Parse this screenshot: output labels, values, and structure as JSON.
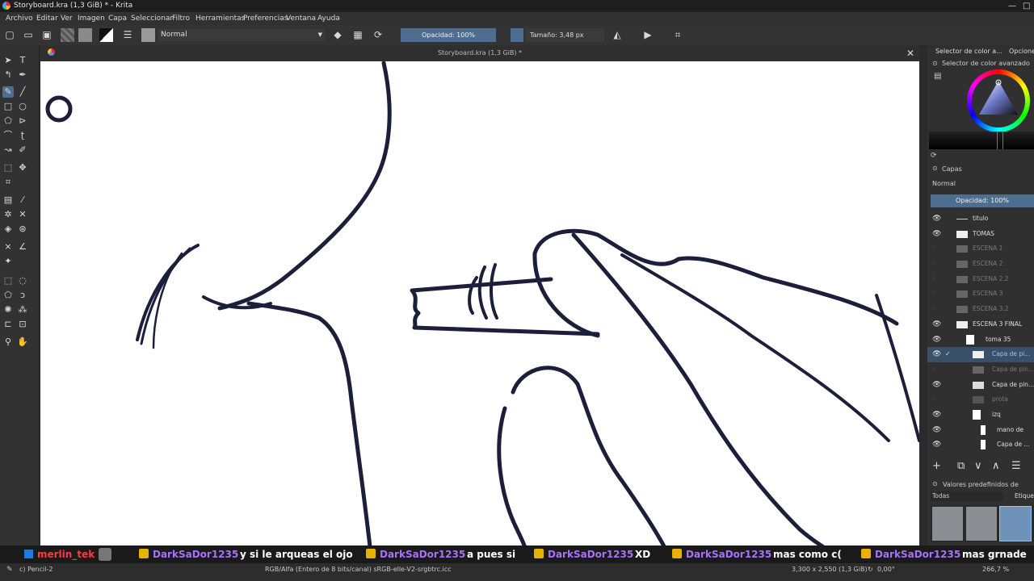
{
  "window": {
    "title": "Storyboard.kra (1,3 GiB) * - Krita"
  },
  "menu": [
    "Archivo",
    "Editar",
    "Ver",
    "Imagen",
    "Capa",
    "Seleccionar",
    "Filtro",
    "Herramientas",
    "Preferencias",
    "Ventana",
    "Ayuda"
  ],
  "toolbar": {
    "blend_mode": "Normal",
    "opacity": "Opacidad: 100%",
    "size": "Tamaño: 3,48 px"
  },
  "document": {
    "tab_title": "Storyboard.kra (1,3 GiB) *"
  },
  "colors": {
    "accent": "#4e6e8f",
    "stroke": "#1c1f3a",
    "canvas": "#ffffff"
  },
  "right_panel": {
    "tab1": "Selector de color a...",
    "tab2": "Opcione",
    "color_selector_title": "Selector de color avanzado",
    "layers_title": "Capas",
    "layers_blend": "Normal",
    "layers_opacity": "Opacidad:  100%",
    "layers": [
      {
        "name": "titulo",
        "visible": true
      },
      {
        "name": "TOMAS",
        "visible": true
      },
      {
        "name": "ESCENA 1",
        "visible": false
      },
      {
        "name": "ESCENA 2",
        "visible": false
      },
      {
        "name": "ESCENA 2.2",
        "visible": false
      },
      {
        "name": "ESCENA 3",
        "visible": false
      },
      {
        "name": "ESCENA 3.2",
        "visible": false
      },
      {
        "name": "ESCENA 3 FINAL",
        "visible": true
      },
      {
        "name": "toma 35",
        "visible": true
      },
      {
        "name": "Capa de pi...",
        "visible": true,
        "selected": true
      },
      {
        "name": "Capa de pin...",
        "visible": false
      },
      {
        "name": "Capa de pin...",
        "visible": true
      },
      {
        "name": "prota",
        "visible": false
      },
      {
        "name": "izq",
        "visible": true
      },
      {
        "name": "mano de",
        "visible": true
      },
      {
        "name": "Capa de ...",
        "visible": true
      }
    ],
    "brush_presets_title": "Valores predefinidos de pincel",
    "brush_filter": "Todas",
    "brush_tag": "Etique"
  },
  "chat": [
    {
      "user": "merlin_tek",
      "msg": "",
      "color": "#ff3b3b"
    },
    {
      "user": "DarkSaDor1235",
      "msg": "y si le arqueas el ojo"
    },
    {
      "user": "DarkSaDor1235",
      "msg": "a pues si"
    },
    {
      "user": "DarkSaDor1235",
      "msg": "XD"
    },
    {
      "user": "DarkSaDor1235",
      "msg": "mas como c("
    },
    {
      "user": "DarkSaDor1235",
      "msg": "mas grnade"
    }
  ],
  "status": {
    "tool": "c) Pencil-2",
    "color_profile": "RGB/Alfa (Entero de 8 bits/canal)  sRGB-elle-V2-srgbtrc.icc",
    "dimensions": "3,300 x 2,550 (1,3 GiB)",
    "rotation": "0,00°",
    "zoom": "266,7 %"
  }
}
